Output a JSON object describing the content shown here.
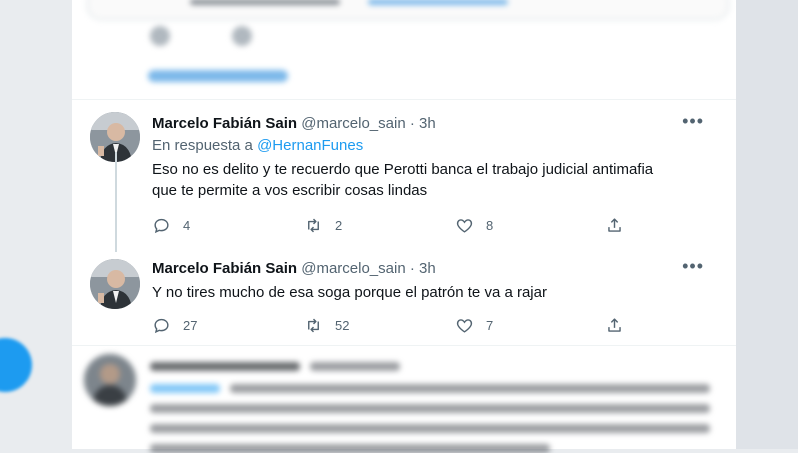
{
  "tweets": [
    {
      "name": "Marcelo Fabián Sain",
      "handle": "@marcelo_sain",
      "separator": "·",
      "time": "3h",
      "reply_prefix": "En respuesta a",
      "reply_mention": "@HernanFunes",
      "text_line1": "Eso no es delito y te recuerdo que Perotti banca el trabajo judicial antimafia",
      "text_line2": "que te permite a vos escribir cosas lindas",
      "replies": "4",
      "retweets": "2",
      "likes": "8",
      "more_label": "•••"
    },
    {
      "name": "Marcelo Fabián Sain",
      "handle": "@marcelo_sain",
      "separator": "·",
      "time": "3h",
      "text_line1": "Y no tires mucho de esa soga porque el patrón te va a rajar",
      "replies": "27",
      "retweets": "52",
      "likes": "7",
      "more_label": "•••"
    }
  ],
  "colors": {
    "accent": "#1d9bf0",
    "text": "#0f1419",
    "secondary": "#536471",
    "divider": "#eff3f4"
  },
  "icons": [
    "reply-icon",
    "retweet-icon",
    "like-icon",
    "share-icon",
    "more-icon"
  ]
}
